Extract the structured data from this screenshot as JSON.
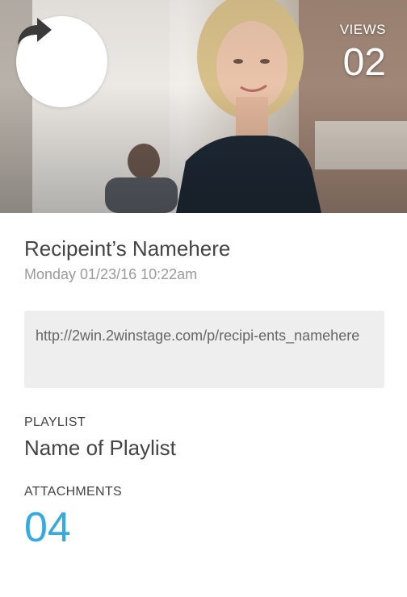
{
  "hero": {
    "share_icon": "share-arrow-icon",
    "views_label": "VIEWS",
    "views_count": "02"
  },
  "recipient": {
    "name": "Recipeint’s Namehere",
    "timestamp": "Monday 01/23/16 10:22am"
  },
  "link": {
    "url": "http://2win.2winstage.com/p/recipi-ents_namehere"
  },
  "playlist": {
    "label": "PLAYLIST",
    "name": "Name of Playlist"
  },
  "attachments": {
    "label": "ATTACHMENTS",
    "count": "04"
  },
  "colors": {
    "accent": "#36a9e1",
    "text": "#444444",
    "muted": "#9a9a9a",
    "url_box": "#eeeeee"
  }
}
